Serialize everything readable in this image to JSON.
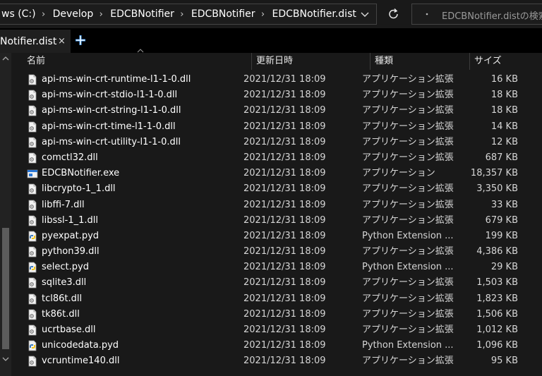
{
  "address": {
    "crumbs": [
      "ws (C:)",
      "Develop",
      "EDCBNotifier",
      "EDCBNotifier",
      "EDCBNotifier.dist"
    ],
    "separator": "›",
    "dropdown_icon": "chevron-down-icon",
    "refresh_icon": "refresh-icon"
  },
  "search": {
    "placeholder": "EDCBNotifier.distの検索",
    "icon": "search-icon"
  },
  "tab": {
    "label": "Notifier.dist",
    "close": "×",
    "new_tab_icon": "plus-icon"
  },
  "columns": {
    "name": "名前",
    "date": "更新日時",
    "type": "種類",
    "size": "サイズ"
  },
  "files": [
    {
      "name": "api-ms-win-crt-runtime-l1-1-0.dll",
      "date": "2021/12/31 18:09",
      "type": "アプリケーション拡張",
      "size": "16 KB",
      "icon": "dll-icon"
    },
    {
      "name": "api-ms-win-crt-stdio-l1-1-0.dll",
      "date": "2021/12/31 18:09",
      "type": "アプリケーション拡張",
      "size": "18 KB",
      "icon": "dll-icon"
    },
    {
      "name": "api-ms-win-crt-string-l1-1-0.dll",
      "date": "2021/12/31 18:09",
      "type": "アプリケーション拡張",
      "size": "18 KB",
      "icon": "dll-icon"
    },
    {
      "name": "api-ms-win-crt-time-l1-1-0.dll",
      "date": "2021/12/31 18:09",
      "type": "アプリケーション拡張",
      "size": "14 KB",
      "icon": "dll-icon"
    },
    {
      "name": "api-ms-win-crt-utility-l1-1-0.dll",
      "date": "2021/12/31 18:09",
      "type": "アプリケーション拡張",
      "size": "12 KB",
      "icon": "dll-icon"
    },
    {
      "name": "comctl32.dll",
      "date": "2021/12/31 18:09",
      "type": "アプリケーション拡張",
      "size": "687 KB",
      "icon": "dll-icon"
    },
    {
      "name": "EDCBNotifier.exe",
      "date": "2021/12/31 18:09",
      "type": "アプリケーション",
      "size": "18,357 KB",
      "icon": "exe-icon"
    },
    {
      "name": "libcrypto-1_1.dll",
      "date": "2021/12/31 18:09",
      "type": "アプリケーション拡張",
      "size": "3,350 KB",
      "icon": "dll-icon"
    },
    {
      "name": "libffi-7.dll",
      "date": "2021/12/31 18:09",
      "type": "アプリケーション拡張",
      "size": "33 KB",
      "icon": "dll-icon"
    },
    {
      "name": "libssl-1_1.dll",
      "date": "2021/12/31 18:09",
      "type": "アプリケーション拡張",
      "size": "679 KB",
      "icon": "dll-icon"
    },
    {
      "name": "pyexpat.pyd",
      "date": "2021/12/31 18:09",
      "type": "Python Extension ...",
      "size": "199 KB",
      "icon": "python-file-icon"
    },
    {
      "name": "python39.dll",
      "date": "2021/12/31 18:09",
      "type": "アプリケーション拡張",
      "size": "4,386 KB",
      "icon": "dll-icon"
    },
    {
      "name": "select.pyd",
      "date": "2021/12/31 18:09",
      "type": "Python Extension ...",
      "size": "29 KB",
      "icon": "python-file-icon"
    },
    {
      "name": "sqlite3.dll",
      "date": "2021/12/31 18:09",
      "type": "アプリケーション拡張",
      "size": "1,503 KB",
      "icon": "dll-icon"
    },
    {
      "name": "tcl86t.dll",
      "date": "2021/12/31 18:09",
      "type": "アプリケーション拡張",
      "size": "1,823 KB",
      "icon": "dll-icon"
    },
    {
      "name": "tk86t.dll",
      "date": "2021/12/31 18:09",
      "type": "アプリケーション拡張",
      "size": "1,506 KB",
      "icon": "dll-icon"
    },
    {
      "name": "ucrtbase.dll",
      "date": "2021/12/31 18:09",
      "type": "アプリケーション拡張",
      "size": "1,012 KB",
      "icon": "dll-icon"
    },
    {
      "name": "unicodedata.pyd",
      "date": "2021/12/31 18:09",
      "type": "Python Extension ...",
      "size": "1,096 KB",
      "icon": "python-file-icon"
    },
    {
      "name": "vcruntime140.dll",
      "date": "2021/12/31 18:09",
      "type": "アプリケーション拡張",
      "size": "95 KB",
      "icon": "dll-icon"
    }
  ],
  "colors": {
    "background": "#191919",
    "tab_active": "#1f1f1f",
    "plus_accent": "#4aa3ff",
    "text": "#ffffff",
    "text_secondary": "#d6d6d6"
  }
}
